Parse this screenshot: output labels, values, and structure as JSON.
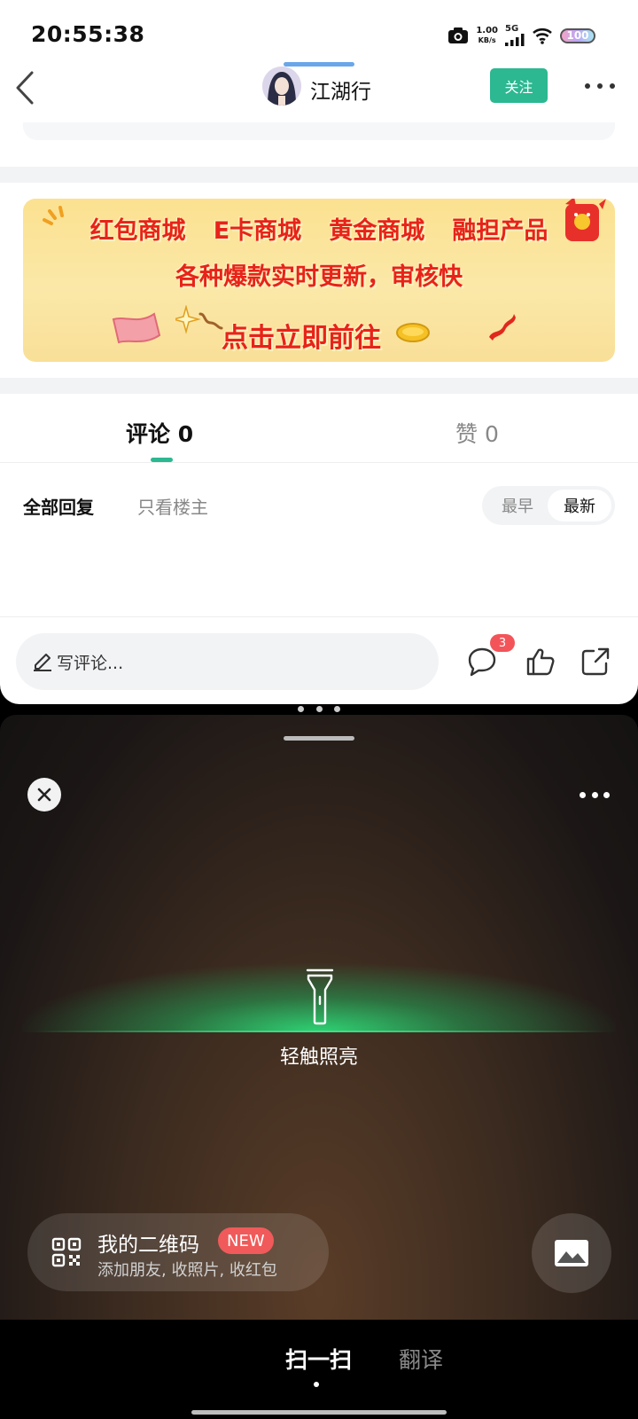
{
  "status_bar": {
    "time": "20:55:38",
    "net_speed_value": "1.00",
    "net_speed_unit": "KB/s",
    "network": "5G",
    "battery": "100"
  },
  "header": {
    "title": "江湖行",
    "follow_label": "关注"
  },
  "banner": {
    "line1": [
      "红包商城",
      "E卡商城",
      "黄金商城",
      "融担产品"
    ],
    "line2": "各种爆款实时更新，审核快",
    "cta": "点击立即前往"
  },
  "tabs": {
    "comments_label": "评论 0",
    "likes_label": "赞 0"
  },
  "filters": {
    "all": "全部回复",
    "op_only": "只看楼主",
    "sort_early": "最早",
    "sort_new": "最新"
  },
  "comment_bar": {
    "placeholder": "写评论...",
    "comment_badge": "3"
  },
  "scanner": {
    "flashlight_label": "轻触照亮",
    "qr_title": "我的二维码",
    "qr_badge": "NEW",
    "qr_subtitle": "添加朋友, 收照片, 收红包"
  },
  "modes": {
    "scan": "扫一扫",
    "translate": "翻译"
  },
  "colors": {
    "accent": "#2cb891",
    "banner_text": "#e7231a",
    "badge": "#f3545a",
    "scan_glow": "#3fe08a"
  }
}
